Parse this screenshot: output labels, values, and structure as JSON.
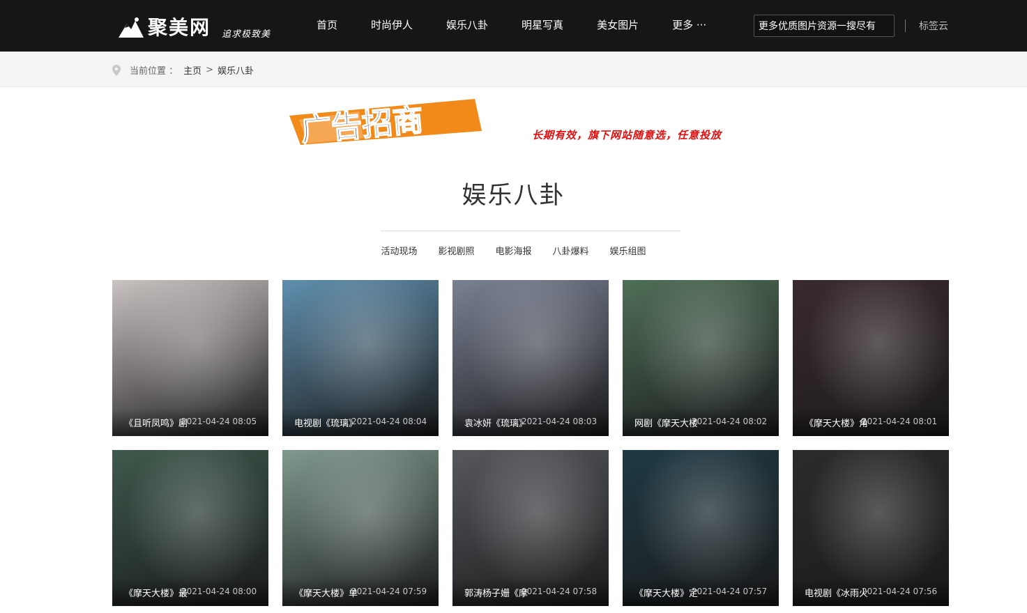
{
  "header": {
    "logo_text": "聚美网",
    "logo_tagline": "追求极致美",
    "nav": [
      "首页",
      "时尚伊人",
      "娱乐八卦",
      "明星写真",
      "美女图片",
      "更多 ···"
    ],
    "search_value": "更多优质图片资源一搜尽有",
    "tag_cloud": "标签云"
  },
  "breadcrumb": {
    "label": "当前位置 ：",
    "home": "主页",
    "separator": ">",
    "current": "娱乐八卦"
  },
  "ad": {
    "headline": "广告招商",
    "slogan": "长期有效，旗下网站随意选，任意投放"
  },
  "category": {
    "title": "娱乐八卦",
    "subcategories": [
      "活动现场",
      "影视剧照",
      "电影海报",
      "八卦爆料",
      "娱乐组图"
    ]
  },
  "cards": [
    {
      "title": "《且听凤鸣》剧",
      "date": "2021-04-24 08:05",
      "color": "#c9c3c1"
    },
    {
      "title": "电视剧《琉璃》",
      "date": "2021-04-24 08:04",
      "color": "#5f8fae"
    },
    {
      "title": "袁冰妍《琉璃》",
      "date": "2021-04-24 08:03",
      "color": "#7a8194"
    },
    {
      "title": "网剧《摩天大楼",
      "date": "2021-04-24 08:02",
      "color": "#4f6f58"
    },
    {
      "title": "《摩天大楼》角",
      "date": "2021-04-24 08:01",
      "color": "#3a2a2e"
    },
    {
      "title": "《摩天大楼》最",
      "date": "2021-04-24 08:00",
      "color": "#3e5a4c"
    },
    {
      "title": "《摩天大楼》单",
      "date": "2021-04-24 07:59",
      "color": "#7f9a8e"
    },
    {
      "title": "郭涛杨子姗《摩",
      "date": "2021-04-24 07:58",
      "color": "#56585d"
    },
    {
      "title": "《摩天大楼》定",
      "date": "2021-04-24 07:57",
      "color": "#1f3a44"
    },
    {
      "title": "电视剧《冰雨火",
      "date": "2021-04-24 07:56",
      "color": "#2d2b2a"
    }
  ],
  "colors": {
    "header_bg": "#161616",
    "crumb_bg": "#f5f5f5",
    "ad_orange": "#f28a1a",
    "ad_red": "#e20f0f"
  }
}
